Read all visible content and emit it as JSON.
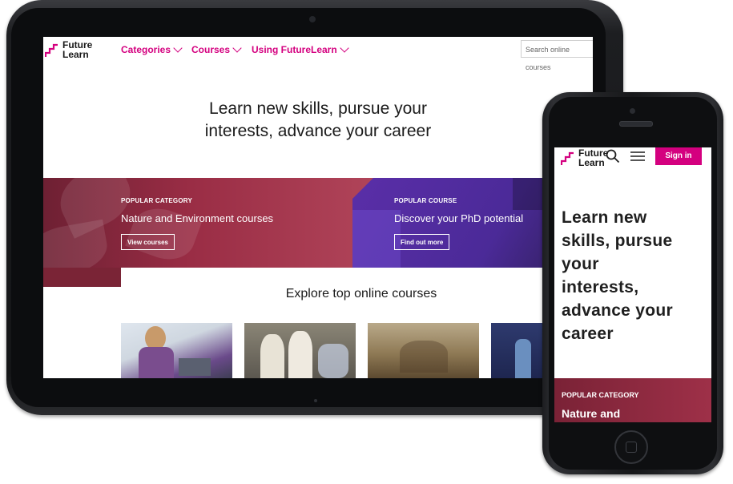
{
  "colors": {
    "brand": "#d4007f",
    "banner_red": "#9a2d45",
    "banner_purple": "#4b2a98"
  },
  "tablet": {
    "logo": {
      "line1": "Future",
      "line2": "Learn"
    },
    "nav": [
      {
        "label": "Categories"
      },
      {
        "label": "Courses"
      },
      {
        "label": "Using FutureLearn"
      }
    ],
    "search_placeholder": "Search online courses",
    "hero": {
      "line1": "Learn new skills, pursue your",
      "line2": "interests, advance your career"
    },
    "banners": [
      {
        "label": "POPULAR CATEGORY",
        "title": "Nature and Environment courses",
        "button": "View courses"
      },
      {
        "label": "POPULAR COURSE",
        "title": "Discover your PhD potential",
        "button": "Find out more"
      }
    ],
    "explore_title": "Explore top online courses"
  },
  "phone": {
    "logo": {
      "line1": "Future",
      "line2": "Learn"
    },
    "icons": [
      "search-icon",
      "menu-icon"
    ],
    "signin": "Sign in",
    "hero": [
      "Learn new",
      "skills, pursue",
      "your",
      "interests,",
      "advance your",
      "career"
    ],
    "banner": {
      "label": "POPULAR CATEGORY",
      "title": "Nature and"
    }
  }
}
